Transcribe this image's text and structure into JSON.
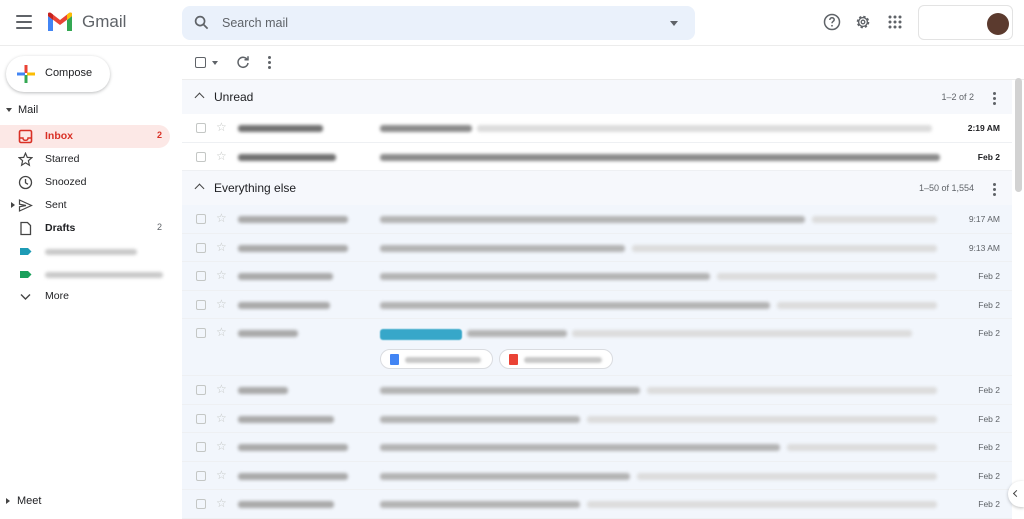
{
  "app": {
    "title": "Gmail",
    "brand_colors": {
      "red": "#ea4335",
      "blue": "#4285f4",
      "yellow": "#fbbc04",
      "green": "#34a853"
    }
  },
  "search": {
    "placeholder": "Search mail",
    "value": ""
  },
  "header": {
    "icons": [
      "help-icon",
      "settings-gear-icon",
      "apps-grid-icon"
    ]
  },
  "sidebar": {
    "compose_label": "Compose",
    "mail_section_label": "Mail",
    "items": [
      {
        "label": "Inbox",
        "count": "2",
        "icon": "inbox-icon",
        "active": true
      },
      {
        "label": "Starred",
        "count": "",
        "icon": "star-icon"
      },
      {
        "label": "Snoozed",
        "count": "",
        "icon": "clock-icon"
      },
      {
        "label": "Sent",
        "count": "",
        "icon": "send-icon"
      },
      {
        "label": "Drafts",
        "count": "2",
        "icon": "draft-icon"
      },
      {
        "label": "",
        "count": "",
        "icon": "label-tag-icon",
        "color": "#1e9bb5"
      },
      {
        "label": "",
        "count": "",
        "icon": "label-tag-icon",
        "color": "#19a05b"
      },
      {
        "label": "More",
        "count": "",
        "icon": "chevron-down-icon"
      }
    ],
    "meet_label": "Meet"
  },
  "sections": {
    "unread": {
      "title": "Unread",
      "count": "1–2 of 2",
      "rows": [
        {
          "date": "2:19 AM"
        },
        {
          "date": "Feb 2"
        }
      ]
    },
    "everything_else": {
      "title": "Everything else",
      "count": "1–50 of 1,554",
      "rows": [
        {
          "date": "9:17 AM"
        },
        {
          "date": "9:13 AM"
        },
        {
          "date": "Feb 2"
        },
        {
          "date": "Feb 2"
        },
        {
          "date": "Feb 2"
        },
        {
          "date": "Feb 2"
        },
        {
          "date": "Feb 2"
        },
        {
          "date": "Feb 2"
        },
        {
          "date": "Feb 2"
        },
        {
          "date": "Feb 2"
        }
      ]
    }
  },
  "attachments": [
    {
      "icon": "google-doc-icon",
      "color": "#4285f4"
    },
    {
      "icon": "pdf-icon",
      "color": "#ea4335"
    }
  ]
}
